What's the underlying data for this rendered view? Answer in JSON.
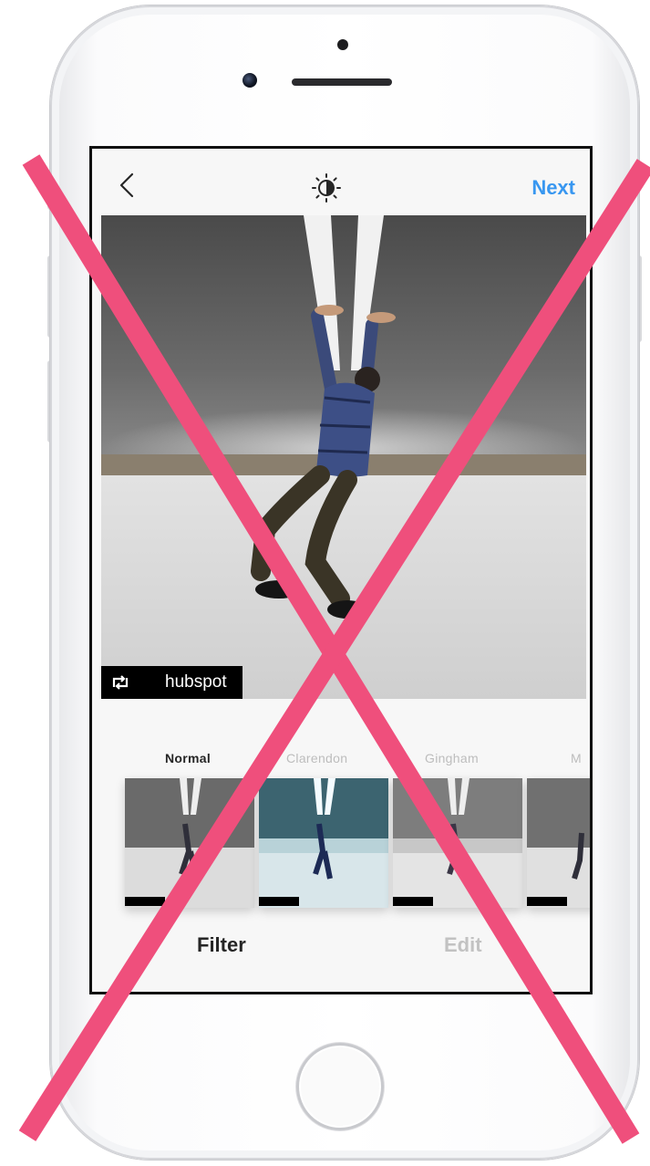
{
  "topbar": {
    "back_icon": "chevron-left-icon",
    "brightness_icon": "brightness-icon",
    "next_label": "Next"
  },
  "photo": {
    "tag": {
      "icon": "repost-icon",
      "username": "hubspot"
    }
  },
  "filters": [
    {
      "label": "Normal",
      "selected": true
    },
    {
      "label": "Clarendon",
      "selected": false
    },
    {
      "label": "Gingham",
      "selected": false
    },
    {
      "label": "M",
      "selected": false
    }
  ],
  "tabs": {
    "filter_label": "Filter",
    "edit_label": "Edit"
  },
  "colors": {
    "accent": "#3897f0",
    "overlay_x": "#ef4f7c"
  }
}
